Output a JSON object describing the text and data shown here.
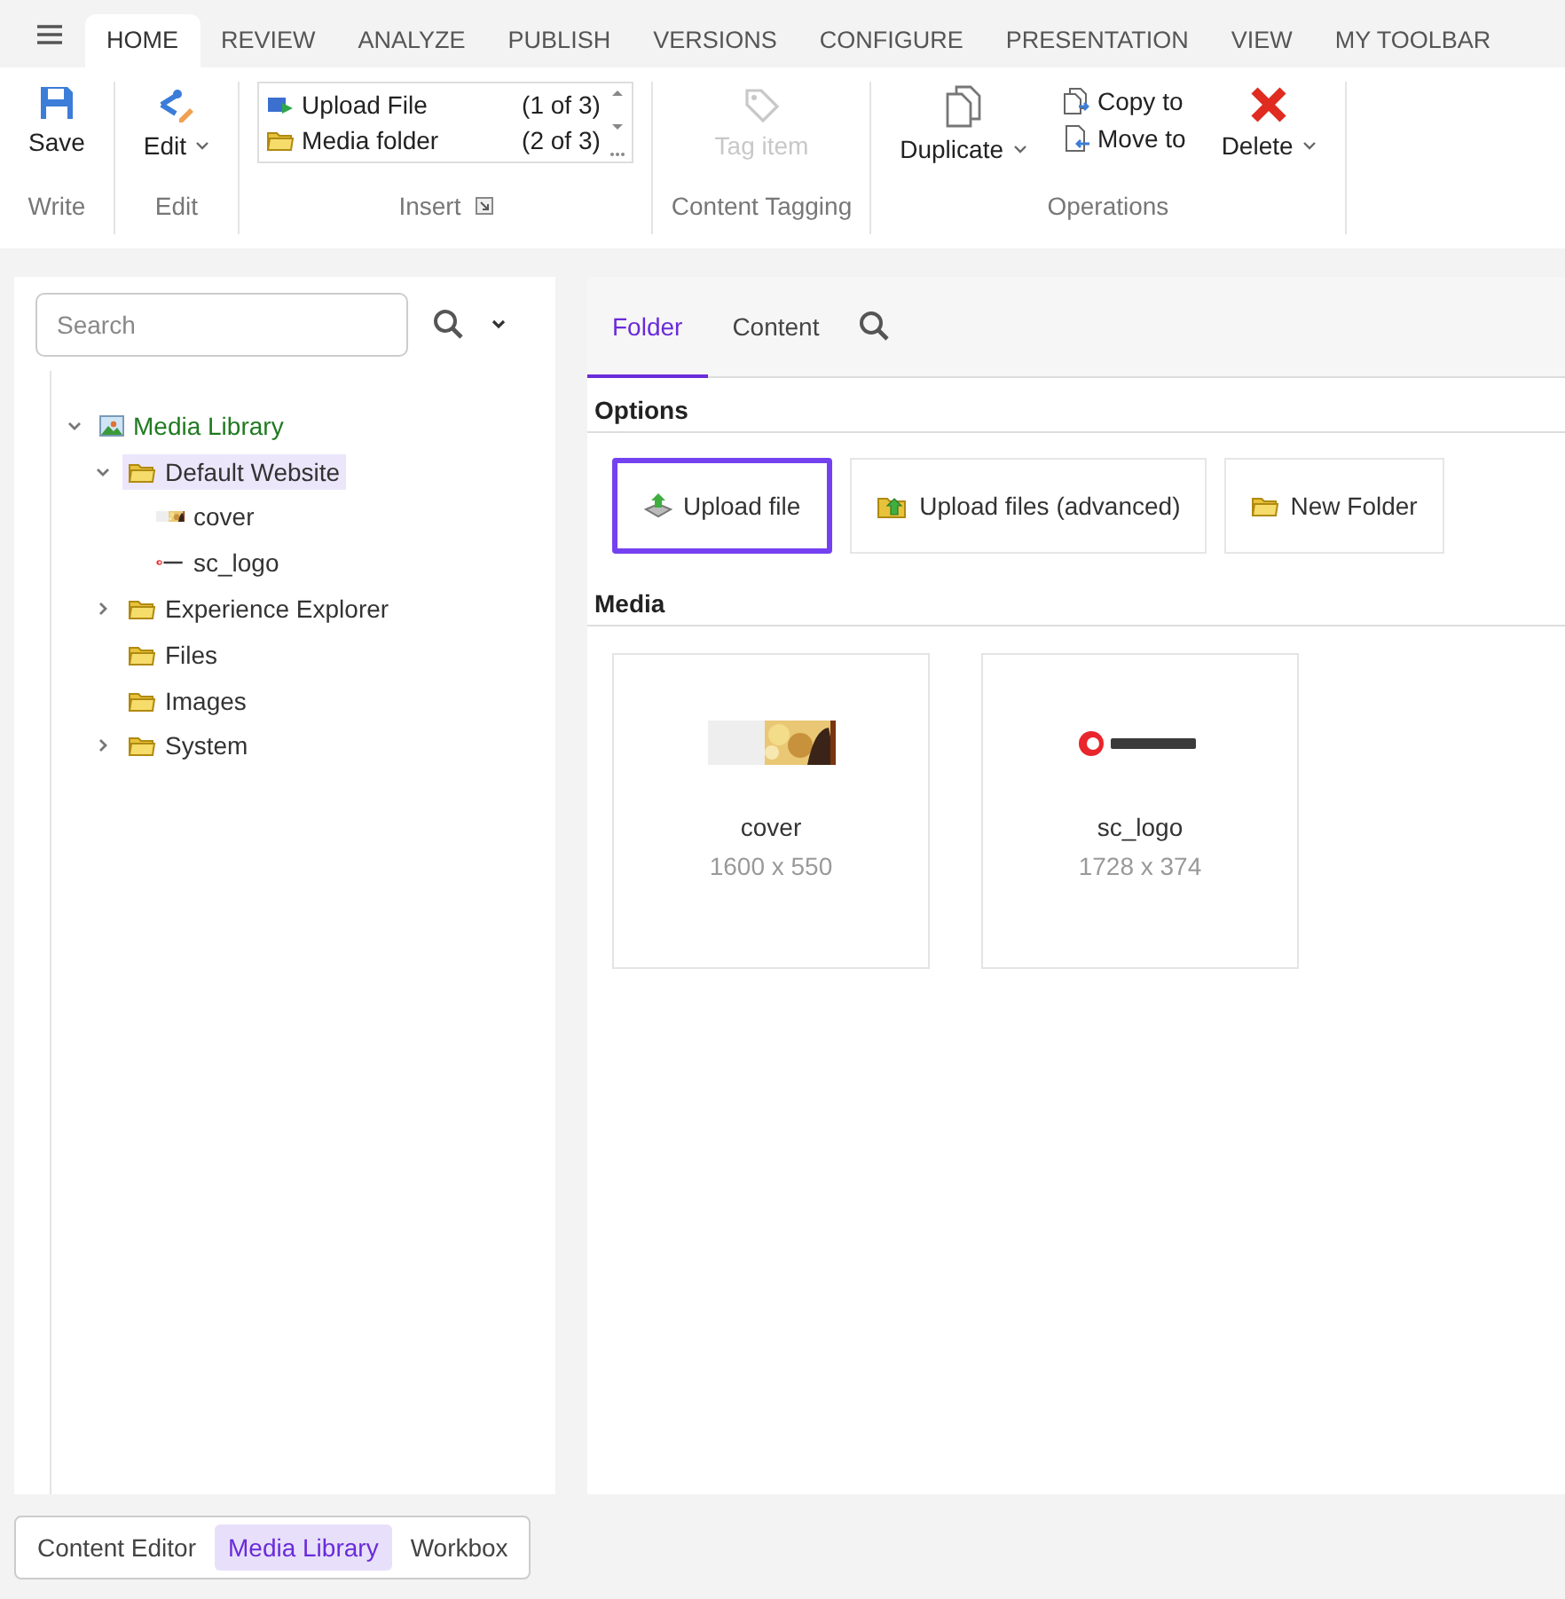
{
  "menu_tabs": [
    {
      "label": "HOME",
      "selected": true
    },
    {
      "label": "REVIEW",
      "selected": false
    },
    {
      "label": "ANALYZE",
      "selected": false
    },
    {
      "label": "PUBLISH",
      "selected": false
    },
    {
      "label": "VERSIONS",
      "selected": false
    },
    {
      "label": "CONFIGURE",
      "selected": false
    },
    {
      "label": "PRESENTATION",
      "selected": false
    },
    {
      "label": "VIEW",
      "selected": false
    },
    {
      "label": "MY TOOLBAR",
      "selected": false
    }
  ],
  "ribbon": [
    {
      "label": "Write",
      "items": [
        {
          "kind": "save",
          "label": "Save",
          "dropdown": false,
          "disabled": false
        }
      ]
    },
    {
      "label": "Edit",
      "items": [
        {
          "kind": "edit",
          "label": "Edit",
          "dropdown": true,
          "disabled": false
        }
      ]
    },
    {
      "label": "Insert",
      "launcher": true,
      "gallery": [
        {
          "kind": "upload",
          "label": "Upload File",
          "count": "(1 of 3)"
        },
        {
          "kind": "folder",
          "label": "Media folder",
          "count": "(2 of 3)"
        }
      ]
    },
    {
      "label": "Content Tagging",
      "items": [
        {
          "kind": "tag",
          "label": "Tag item",
          "dropdown": false,
          "disabled": true
        }
      ]
    },
    {
      "label": "Operations",
      "items": [
        {
          "kind": "duplicate",
          "label": "Duplicate",
          "dropdown": true,
          "disabled": false
        },
        {
          "kind": "stack",
          "entries": [
            {
              "kind": "copy",
              "label": "Copy to"
            },
            {
              "kind": "move",
              "label": "Move to"
            }
          ]
        },
        {
          "kind": "delete",
          "label": "Delete",
          "dropdown": true,
          "disabled": false
        }
      ]
    }
  ],
  "search": {
    "placeholder": "Search"
  },
  "tree": [
    {
      "kind": "library",
      "label": "Media Library",
      "expanded": true,
      "selected": false,
      "children": [
        {
          "kind": "folder",
          "label": "Default Website",
          "expanded": true,
          "selected": true,
          "children": [
            {
              "kind": "cover",
              "label": "cover",
              "selected": false
            },
            {
              "kind": "logo",
              "label": "sc_logo",
              "selected": false
            }
          ]
        },
        {
          "kind": "folder",
          "label": "Experience Explorer",
          "expanded": false,
          "selected": false
        },
        {
          "kind": "folder",
          "label": "Files",
          "selected": false
        },
        {
          "kind": "folder",
          "label": "Images",
          "selected": false
        },
        {
          "kind": "folder",
          "label": "System",
          "expanded": false,
          "selected": false
        }
      ]
    }
  ],
  "panel_tabs": [
    {
      "label": "Folder",
      "selected": true
    },
    {
      "label": "Content",
      "selected": false
    }
  ],
  "options": {
    "title": "Options",
    "buttons": [
      {
        "kind": "upload",
        "label": "Upload file",
        "highlighted": true
      },
      {
        "kind": "upload-advanced",
        "label": "Upload files (advanced)",
        "highlighted": false
      },
      {
        "kind": "folder",
        "label": "New Folder",
        "highlighted": false
      }
    ]
  },
  "media": {
    "title": "Media",
    "items": [
      {
        "kind": "cover",
        "name": "cover",
        "size": "1600 x 550"
      },
      {
        "kind": "logo",
        "name": "sc_logo",
        "size": "1728 x 374"
      }
    ]
  },
  "bottom_tabs": [
    {
      "label": "Content Editor",
      "selected": false
    },
    {
      "label": "Media Library",
      "selected": true
    },
    {
      "label": "Workbox",
      "selected": false
    }
  ]
}
